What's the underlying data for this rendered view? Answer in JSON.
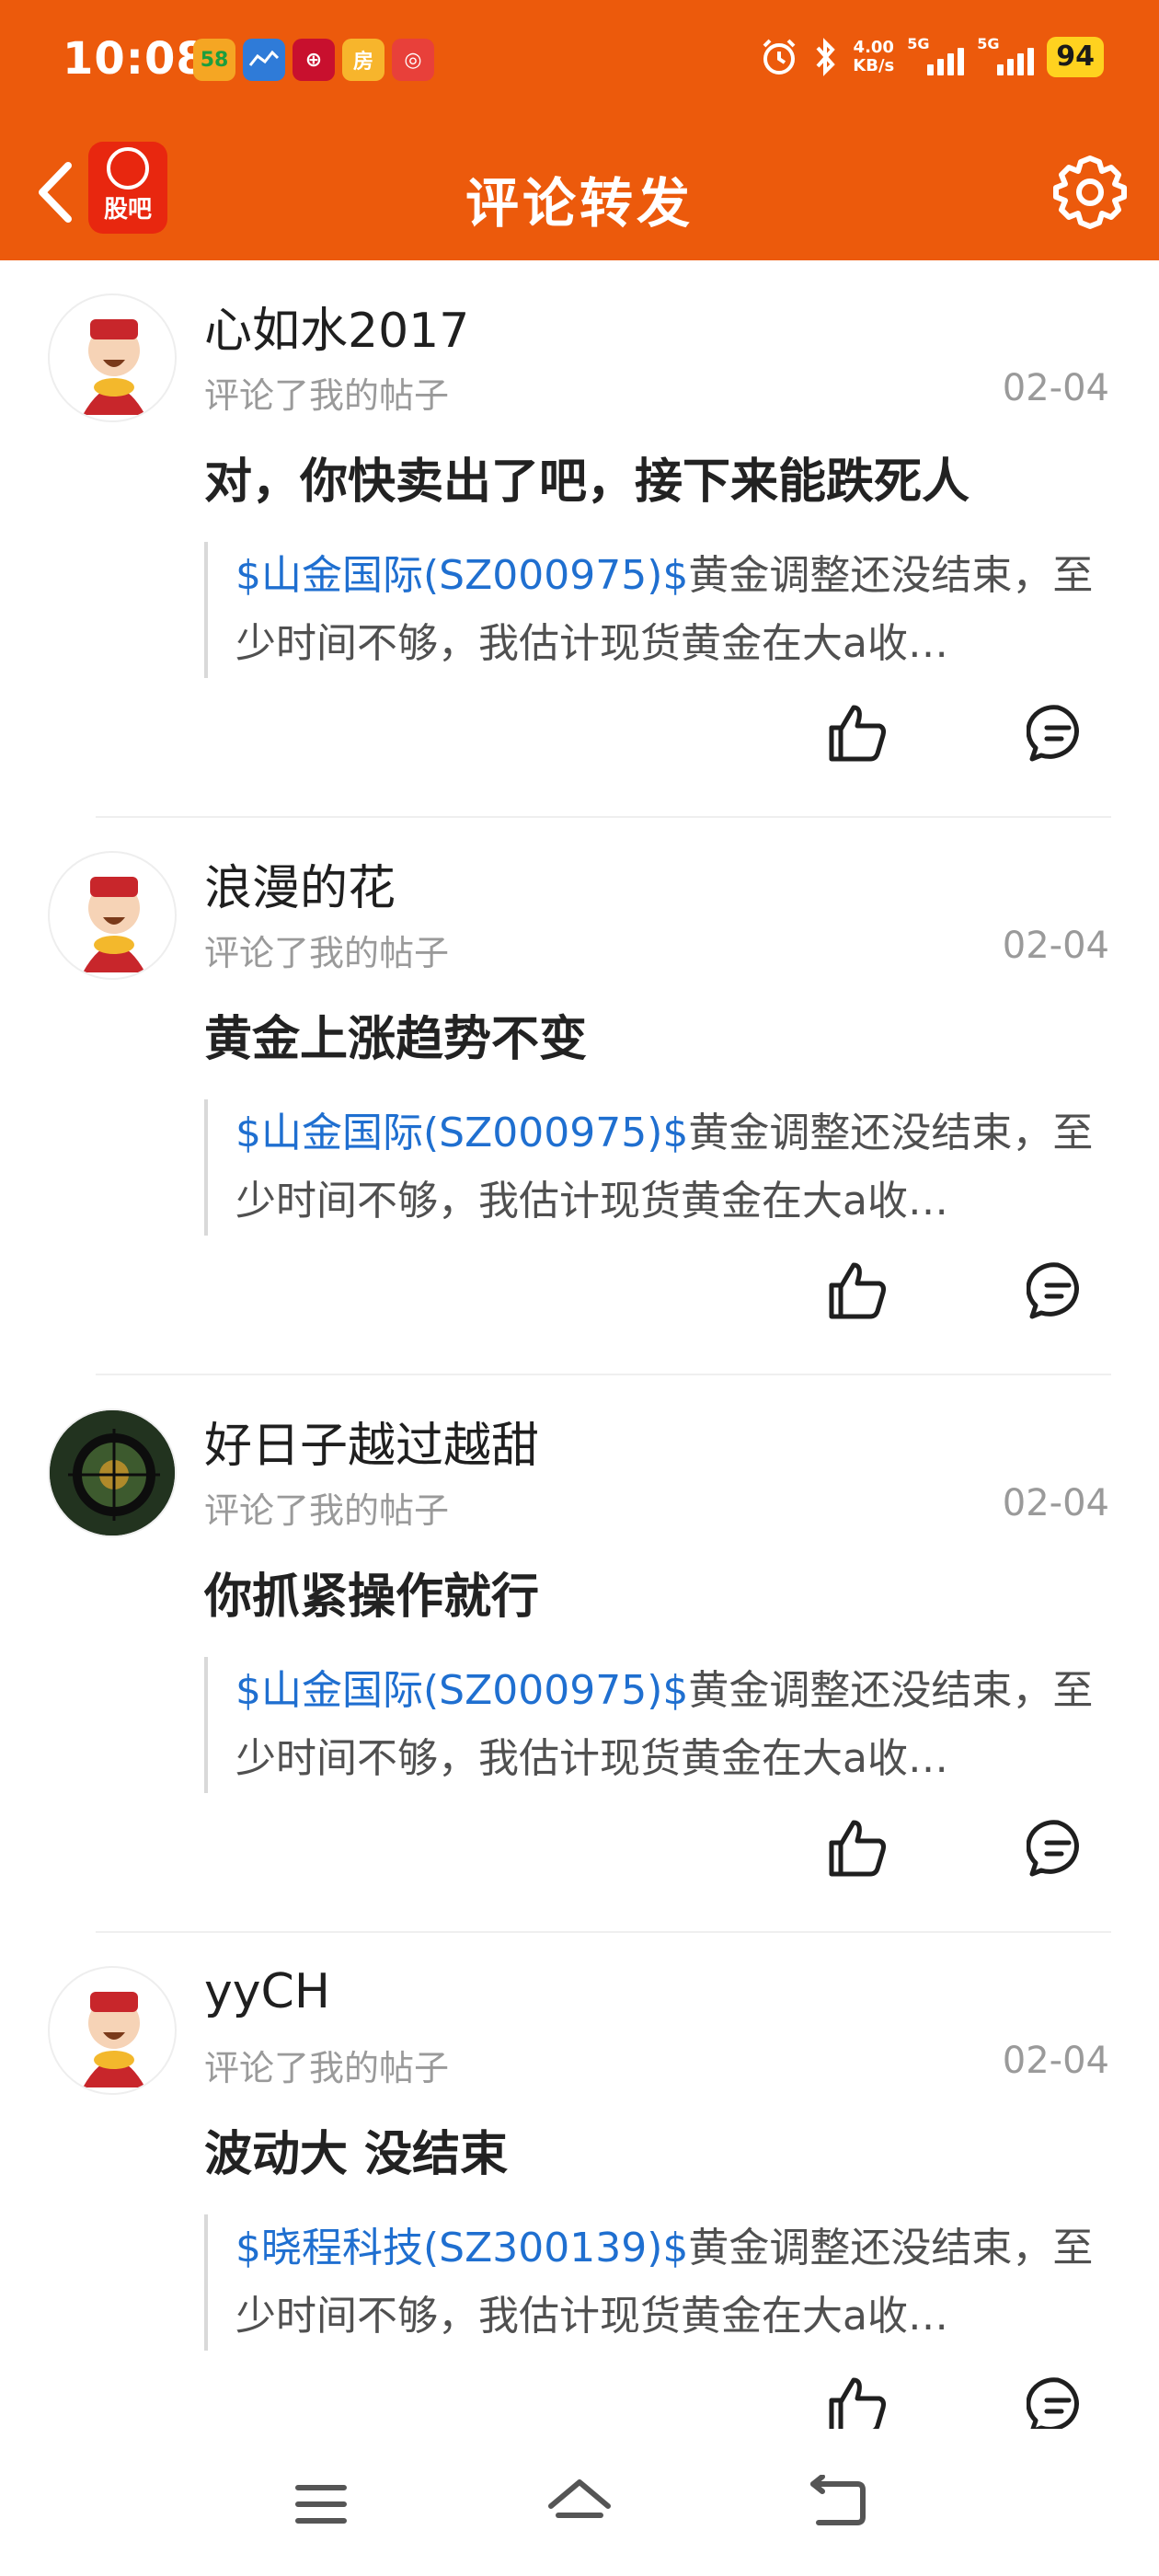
{
  "status_bar": {
    "time": "10:08",
    "app_icons": [
      {
        "name": "58-app-icon",
        "text": "58"
      },
      {
        "name": "map-app-icon",
        "text": ""
      },
      {
        "name": "bank-app-icon",
        "text": "⊕"
      },
      {
        "name": "house-app-icon",
        "text": "房"
      },
      {
        "name": "shop-app-icon",
        "text": "◎"
      }
    ],
    "net_speed_value": "4.00",
    "net_speed_unit": "KB/s",
    "signal1_label": "5G",
    "signal2_label": "5G",
    "battery": "94"
  },
  "header": {
    "logo_text": "股吧",
    "title": "评论转发"
  },
  "comments": [
    {
      "username": "心如水2017",
      "subtitle": "评论了我的帖子",
      "date": "02-04",
      "text": "对，你快卖出了吧，接下来能跌死人",
      "quote_link": "$山金国际(SZ000975)$",
      "quote_text": "黄金调整还没结束，至少时间不够，我估计现货黄金在大a收…"
    },
    {
      "username": "浪漫的花",
      "subtitle": "评论了我的帖子",
      "date": "02-04",
      "text": "黄金上涨趋势不变",
      "quote_link": "$山金国际(SZ000975)$",
      "quote_text": "黄金调整还没结束，至少时间不够，我估计现货黄金在大a收…"
    },
    {
      "username": "好日子越过越甜",
      "subtitle": "评论了我的帖子",
      "date": "02-04",
      "text": "你抓紧操作就行",
      "quote_link": "$山金国际(SZ000975)$",
      "quote_text": "黄金调整还没结束，至少时间不够，我估计现货黄金在大a收…"
    },
    {
      "username": "yyCH",
      "subtitle": "评论了我的帖子",
      "date": "02-04",
      "text": "波动大 没结束",
      "quote_link": "$晓程科技(SZ300139)$",
      "quote_text": "黄金调整还没结束，至少时间不够，我估计现货黄金在大a收…"
    }
  ],
  "colors": {
    "brand": "#ec5a0c",
    "link": "#1f6fd0",
    "battery": "#ffd21f"
  }
}
